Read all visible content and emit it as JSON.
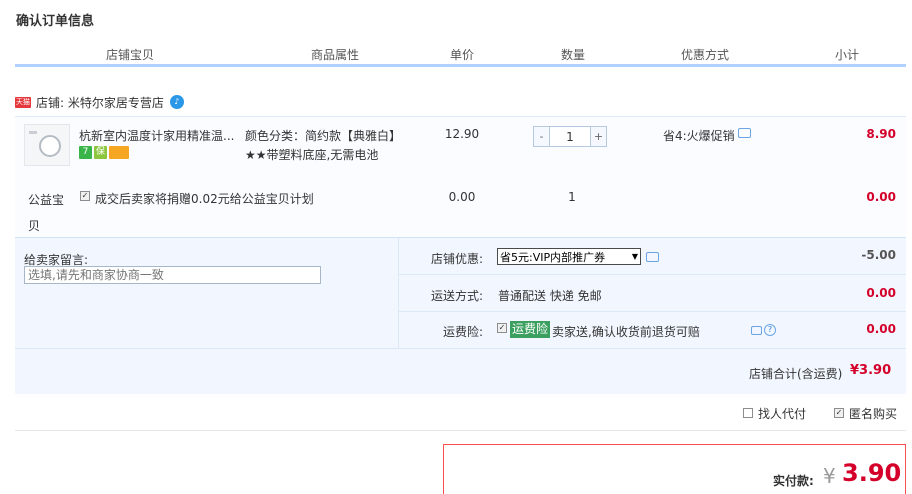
{
  "page": {
    "title": "确认订单信息"
  },
  "columns": [
    "店铺宝贝",
    "商品属性",
    "单价",
    "数量",
    "优惠方式",
    "小计"
  ],
  "shop": {
    "badge": "天猫",
    "label": "店铺: 米特尔家居专营店",
    "chat_icon": "wangwang-chat-icon"
  },
  "product": {
    "name": "杭新室内温度计家用精准温...",
    "attr_line1": "颜色分类：简约款【典雅白】",
    "attr_line2": "★★带塑料底座,无需电池",
    "unit_price": "12.90",
    "quantity": "1",
    "qty_minus": "-",
    "qty_plus": "+",
    "promo": "省4:火爆促销",
    "subtotal": "8.90",
    "services": [
      {
        "icon": "seven-day-return-icon",
        "text": "7",
        "color": "#3ab54a"
      },
      {
        "icon": "quality-guarantee-icon",
        "text": "保",
        "color": "#8cc63f"
      },
      {
        "icon": "credit-card-icon",
        "text": "",
        "color": "#f5a623"
      }
    ]
  },
  "charity": {
    "label": "公益宝贝",
    "text": "成交后卖家将捐赠0.02元给公益宝贝计划",
    "price": "0.00",
    "quantity": "1",
    "subtotal": "0.00"
  },
  "message": {
    "label": "给卖家留言:",
    "placeholder": "选填,请先和商家协商一致"
  },
  "coupon": {
    "label": "店铺优惠:",
    "selected": "省5元:VIP内部推广券",
    "value": "-5.00"
  },
  "shipping": {
    "label": "运送方式:",
    "text": "普通配送 快递 免邮",
    "value": "0.00"
  },
  "insurance": {
    "label": "运费险:",
    "tag": "运费险",
    "text": "卖家送,确认收货前退货可赔",
    "value": "0.00"
  },
  "shop_total": {
    "label": "店铺合计(含运费)",
    "value": "¥3.90"
  },
  "options": {
    "proxy_pay": "找人代付",
    "anonymous": "匿名购买"
  },
  "payment": {
    "label": "实付款:",
    "currency": "¥",
    "amount": "3.90"
  },
  "colors": {
    "price_red": "#d4002a",
    "header_blue": "#b2d1ff",
    "info_bg": "#f2f7ff",
    "pay_border": "#ff4d4d"
  }
}
